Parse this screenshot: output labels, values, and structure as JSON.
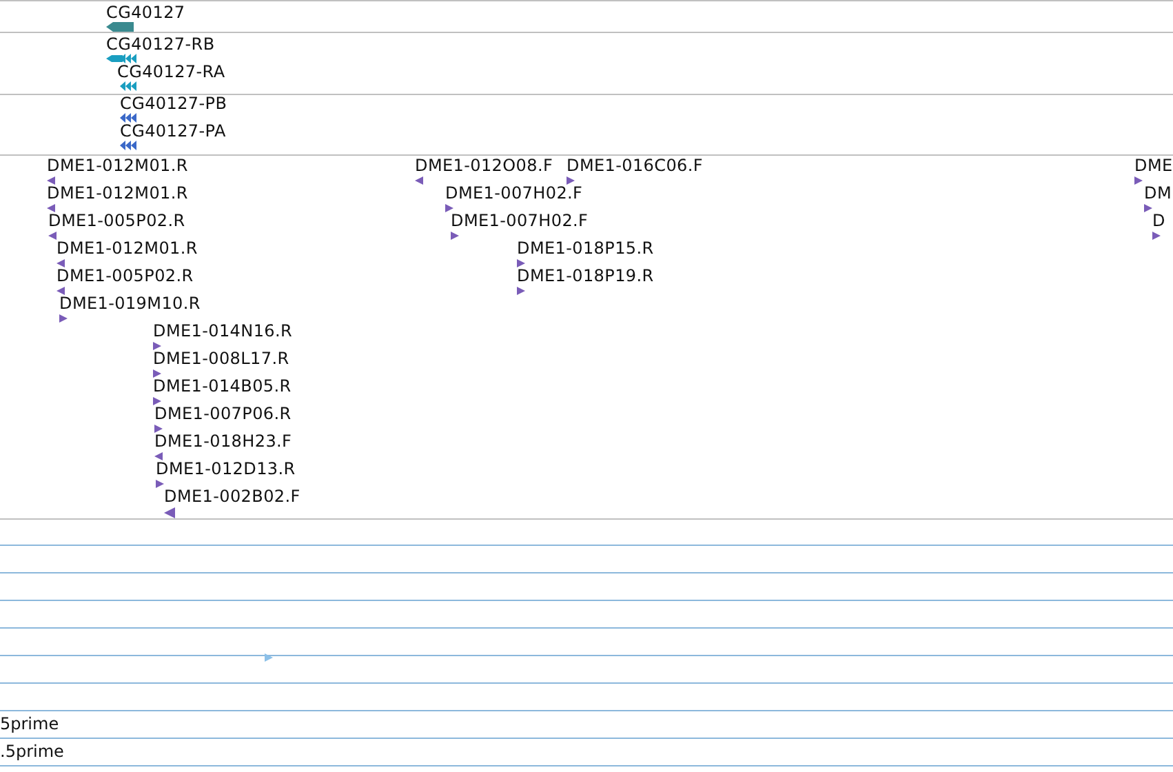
{
  "tracks": [
    {
      "kind": "gene",
      "color": "#3a8a8f",
      "features": [
        {
          "label": "CG40127",
          "points_left": true
        }
      ]
    },
    {
      "kind": "transcript",
      "color": "#1a9ec0",
      "features": [
        {
          "label": "CG40127-RB",
          "points_left": true
        },
        {
          "label": "CG40127-RA",
          "points_left": true
        }
      ]
    },
    {
      "kind": "protein",
      "color": "#3a68c8",
      "features": [
        {
          "label": "CG40127-PB",
          "points_left": true
        },
        {
          "label": "CG40127-PA",
          "points_left": true
        }
      ]
    },
    {
      "kind": "est",
      "color": "#7a5cb8",
      "features": [
        {
          "label": "DME1-012M01.R",
          "points_left": true
        },
        {
          "label": "DME1-012M01.R",
          "points_left": true
        },
        {
          "label": "DME1-005P02.R",
          "points_left": true
        },
        {
          "label": "DME1-012M01.R",
          "points_left": true
        },
        {
          "label": "DME1-005P02.R",
          "points_left": true
        },
        {
          "label": "DME1-019M10.R",
          "points_left": false
        },
        {
          "label": "DME1-014N16.R",
          "points_left": false
        },
        {
          "label": "DME1-008L17.R",
          "points_left": false
        },
        {
          "label": "DME1-014B05.R",
          "points_left": false
        },
        {
          "label": "DME1-007P06.R",
          "points_left": false
        },
        {
          "label": "DME1-018H23.F",
          "points_left": true
        },
        {
          "label": "DME1-012D13.R",
          "points_left": false
        },
        {
          "label": "DME1-002B02.F",
          "points_left": true
        },
        {
          "label": "DME1-012O08.F",
          "points_left": true
        },
        {
          "label": "DME1-016C06.F",
          "points_left": false
        },
        {
          "label": "DME1-007H02.F",
          "points_left": false
        },
        {
          "label": "DME1-007H02.F",
          "points_left": false
        },
        {
          "label": "DME1-018P15.R",
          "points_left": false
        },
        {
          "label": "DME1-018P19.R",
          "points_left": false
        },
        {
          "label": "DME",
          "points_left": false
        },
        {
          "label": "DM",
          "points_left": false
        },
        {
          "label": "D",
          "points_left": false
        }
      ]
    },
    {
      "kind": "empty"
    },
    {
      "kind": "empty"
    },
    {
      "kind": "empty"
    },
    {
      "kind": "empty"
    },
    {
      "kind": "est",
      "color": "#8cc0e8",
      "features": [
        {
          "points_left": false
        }
      ]
    },
    {
      "kind": "empty"
    },
    {
      "kind": "empty"
    },
    {
      "kind": "label",
      "text": "5prime"
    },
    {
      "kind": "label",
      "text": ".5prime"
    }
  ]
}
